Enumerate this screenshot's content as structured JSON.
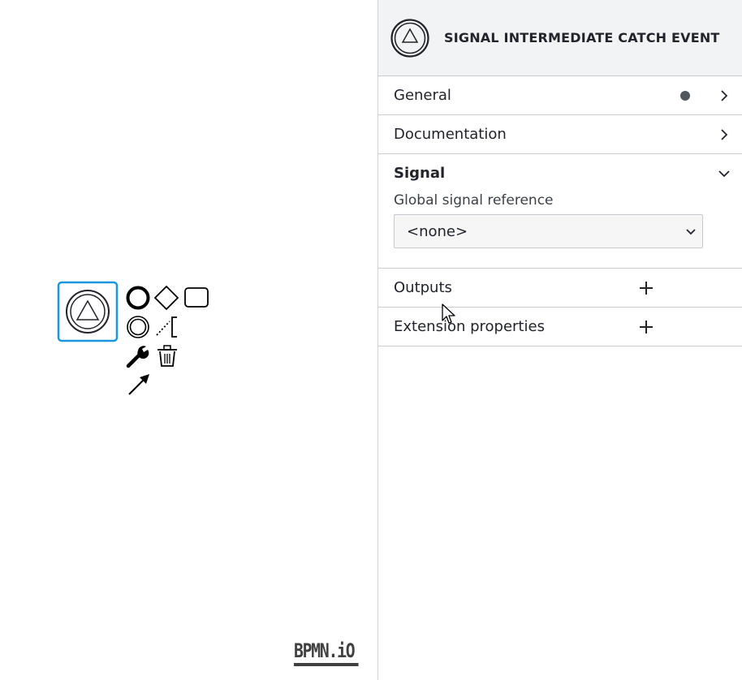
{
  "panel": {
    "header_title": "SIGNAL INTERMEDIATE CATCH EVENT",
    "header_icon": "signal-catch-event-icon",
    "groups": [
      {
        "title": "General",
        "icon": "chevron-right-icon",
        "has_indicator": true
      },
      {
        "title": "Documentation",
        "icon": "chevron-right-icon"
      },
      {
        "title": "Signal",
        "icon": "chevron-down-icon",
        "expanded": true
      },
      {
        "title": "Outputs",
        "icon": "plus-icon"
      },
      {
        "title": "Extension properties",
        "icon": "plus-icon"
      }
    ],
    "signal": {
      "field_label": "Global signal reference",
      "select_value": "<none>"
    }
  },
  "canvas": {
    "selected_element": "signal-intermediate-catch-event",
    "context_pad": [
      "append-end-event-icon",
      "append-gateway-icon",
      "append-task-icon",
      "append-intermediate-event-icon",
      "text-annotation-icon",
      "wrench-icon",
      "trash-icon",
      "connect-arrow-icon"
    ],
    "selection_color": "#1a95e0",
    "logo": "BPMN.iO"
  }
}
